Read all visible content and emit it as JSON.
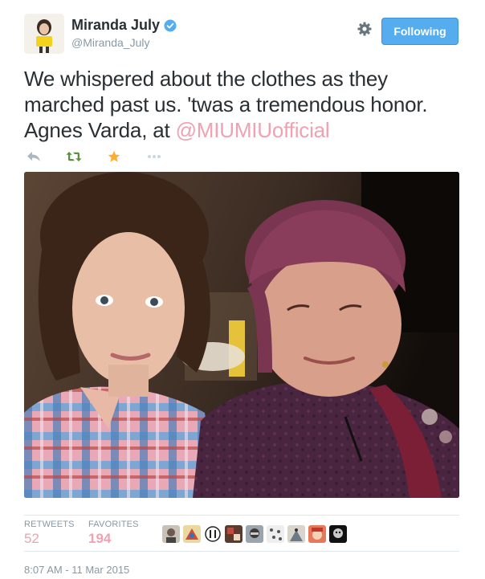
{
  "user": {
    "display_name": "Miranda July",
    "handle": "@Miranda_July",
    "verified": true
  },
  "follow_button": {
    "label": "Following"
  },
  "tweet": {
    "text_lines": [
      "We whispered about the clothes as they",
      "marched past us. 'twas a tremendous honor.",
      "Agnes Varda, at "
    ],
    "mention": "@MIUMIUofficial"
  },
  "actions": {
    "icons": [
      "reply-icon",
      "retweet-icon",
      "favorite-icon",
      "more-icon"
    ]
  },
  "stats": {
    "retweets_label": "RETWEETS",
    "retweets_value": "52",
    "favorites_label": "FAVORITES",
    "favorites_value": "194"
  },
  "favoriters_count_shown": 9,
  "timestamp": "8:07 AM - 11 Mar 2015",
  "colors": {
    "accent": "#55acee",
    "mention": "#f0a2b0",
    "favorited_star": "#ffac33",
    "retweeted": "#5c913b",
    "muted_text": "#8899a6"
  }
}
